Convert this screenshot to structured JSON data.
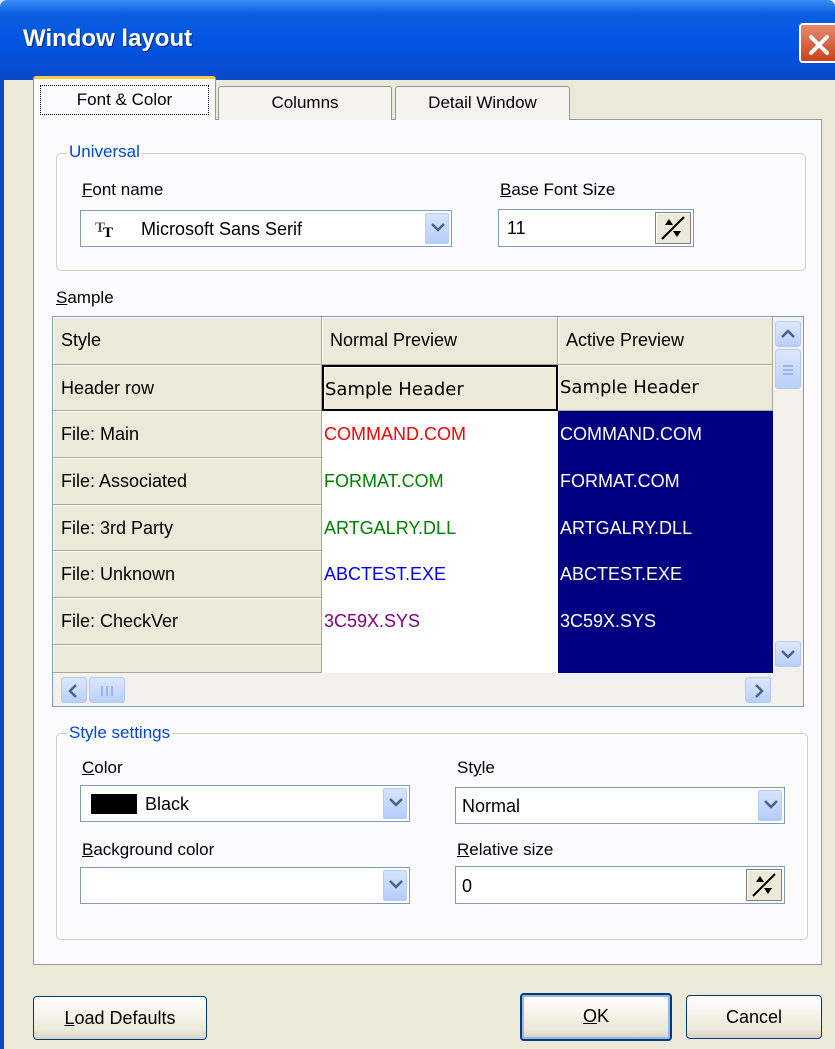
{
  "window": {
    "title": "Window layout"
  },
  "tabs": [
    "Font & Color",
    "Columns",
    "Detail Window"
  ],
  "universal": {
    "legend": "Universal",
    "font_name_label": "Font name",
    "font_name_value": "Microsoft Sans Serif",
    "font_icon": "truetype-font-icon",
    "base_font_size_label": "Base Font Size",
    "base_font_size_value": "11"
  },
  "sample": {
    "label": "Sample",
    "columns": [
      "Style",
      "Normal Preview",
      "Active Preview"
    ],
    "rows": [
      {
        "style": "Header row",
        "normal": "Sample Header",
        "active": "Sample Header",
        "color": "#000000"
      },
      {
        "style": "File: Main",
        "normal": "COMMAND.COM",
        "active": "COMMAND.COM",
        "color": "#ff0000"
      },
      {
        "style": "File: Associated",
        "normal": "FORMAT.COM",
        "active": "FORMAT.COM",
        "color": "#008000"
      },
      {
        "style": "File: 3rd Party",
        "normal": "ARTGALRY.DLL",
        "active": "ARTGALRY.DLL",
        "color": "#008000"
      },
      {
        "style": "File: Unknown",
        "normal": "ABCTEST.EXE",
        "active": "ABCTEST.EXE",
        "color": "#0000ff"
      },
      {
        "style": "File: CheckVer",
        "normal": "3C59X.SYS",
        "active": "3C59X.SYS",
        "color": "#800080"
      }
    ],
    "active_bg": "#000080"
  },
  "style_settings": {
    "legend": "Style settings",
    "color_label": "Color",
    "color_value": "Black",
    "color_swatch": "#000000",
    "style_label": "Style",
    "style_value": "Normal",
    "bg_color_label": "Background color",
    "bg_color_value": "",
    "relative_size_label": "Relative size",
    "relative_size_value": "0"
  },
  "buttons": {
    "load_defaults": "Load Defaults",
    "ok": "OK",
    "cancel": "Cancel"
  }
}
